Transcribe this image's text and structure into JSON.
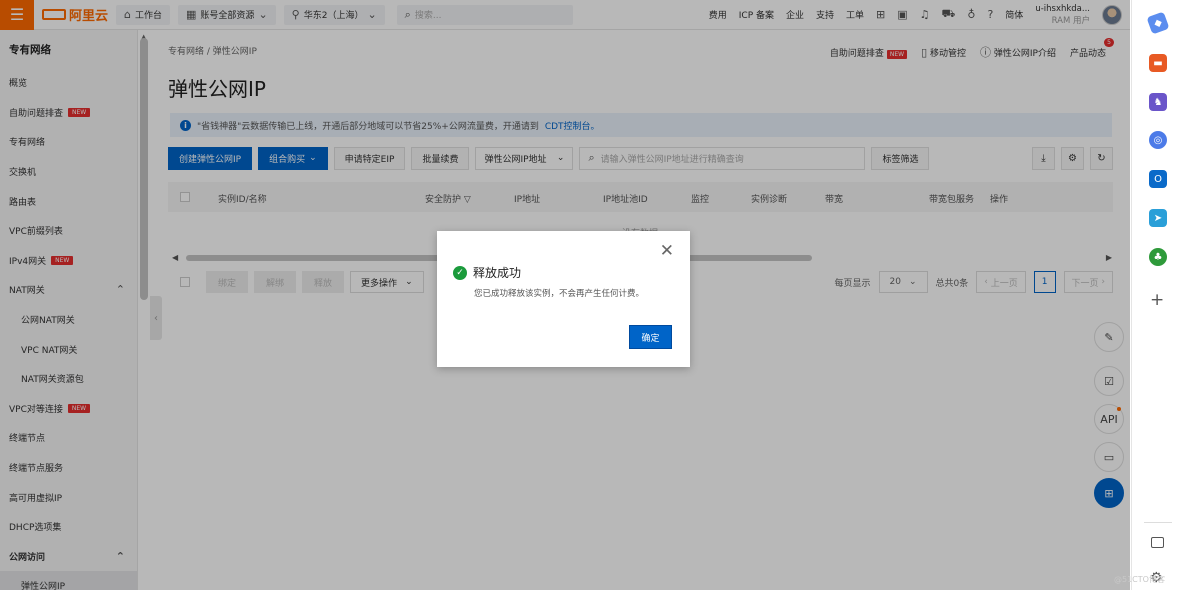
{
  "topbar": {
    "logo": "阿里云",
    "workbench": "工作台",
    "resource_scope": "账号全部资源",
    "region": "华东2（上海）",
    "search_placeholder": "搜索...",
    "links": [
      "费用",
      "ICP 备案",
      "企业",
      "支持",
      "工单"
    ],
    "lang": "简体",
    "user_name": "u-ihsxhkda...",
    "user_role": "RAM 用户"
  },
  "sidebar": {
    "title": "专有网络",
    "items": [
      {
        "label": "概览"
      },
      {
        "label": "自助问题排查",
        "badge": "NEW"
      },
      {
        "label": "专有网络"
      },
      {
        "label": "交换机"
      },
      {
        "label": "路由表"
      },
      {
        "label": "VPC前缀列表"
      },
      {
        "label": "IPv4网关",
        "badge": "NEW"
      },
      {
        "label": "NAT网关",
        "group": true
      },
      {
        "label": "公网NAT网关",
        "sub": true
      },
      {
        "label": "VPC NAT网关",
        "sub": true
      },
      {
        "label": "NAT网关资源包",
        "sub": true
      },
      {
        "label": "VPC对等连接",
        "badge": "NEW"
      },
      {
        "label": "终端节点"
      },
      {
        "label": "终端节点服务"
      },
      {
        "label": "高可用虚拟IP"
      },
      {
        "label": "DHCP选项集"
      },
      {
        "label": "公网访问",
        "group": true
      },
      {
        "label": "弹性公网IP",
        "sub": true,
        "active": true
      }
    ]
  },
  "main": {
    "breadcrumb": [
      "专有网络",
      "弹性公网IP"
    ],
    "actions": {
      "troubleshoot": "自助问题排查",
      "troubleshoot_badge": "NEW",
      "monitor": "移动管控",
      "intro": "弹性公网IP介绍",
      "news": "产品动态",
      "news_count": "5"
    },
    "title": "弹性公网IP",
    "notice_text": "\"省钱神器\"云数据传输已上线，开通后部分地域可以节省25%+公网流量费，开通请到",
    "notice_link": "CDT控制台。",
    "toolbar": {
      "create": "创建弹性公网IP",
      "combo": "组合购买",
      "apply": "申请特定EIP",
      "renew": "批量续费",
      "filter_select": "弹性公网IP地址",
      "search_placeholder": "请输入弹性公网IP地址进行精确查询",
      "tag_filter": "标签筛选"
    },
    "table": {
      "columns": [
        "实例ID/名称",
        "安全防护",
        "IP地址",
        "IP地址池ID",
        "监控",
        "实例诊断",
        "带宽",
        "带宽包服务",
        "操作"
      ],
      "empty_text": "没有数据"
    },
    "footer": {
      "buttons": [
        "绑定",
        "解绑",
        "释放"
      ],
      "more": "更多操作",
      "per_page_label": "每页显示",
      "per_page": "20",
      "total": "总共0条",
      "prev": "上一页",
      "page": "1",
      "next": "下一页"
    }
  },
  "modal": {
    "title": "释放成功",
    "message": "您已成功释放该实例，不会再产生任何计费。",
    "ok": "确定"
  },
  "colors": {
    "brand": "#ff6a00",
    "primary": "#0064c8",
    "success": "#1b9b3c",
    "badge": "#e62e2e"
  },
  "watermark": "@51CTO博客"
}
